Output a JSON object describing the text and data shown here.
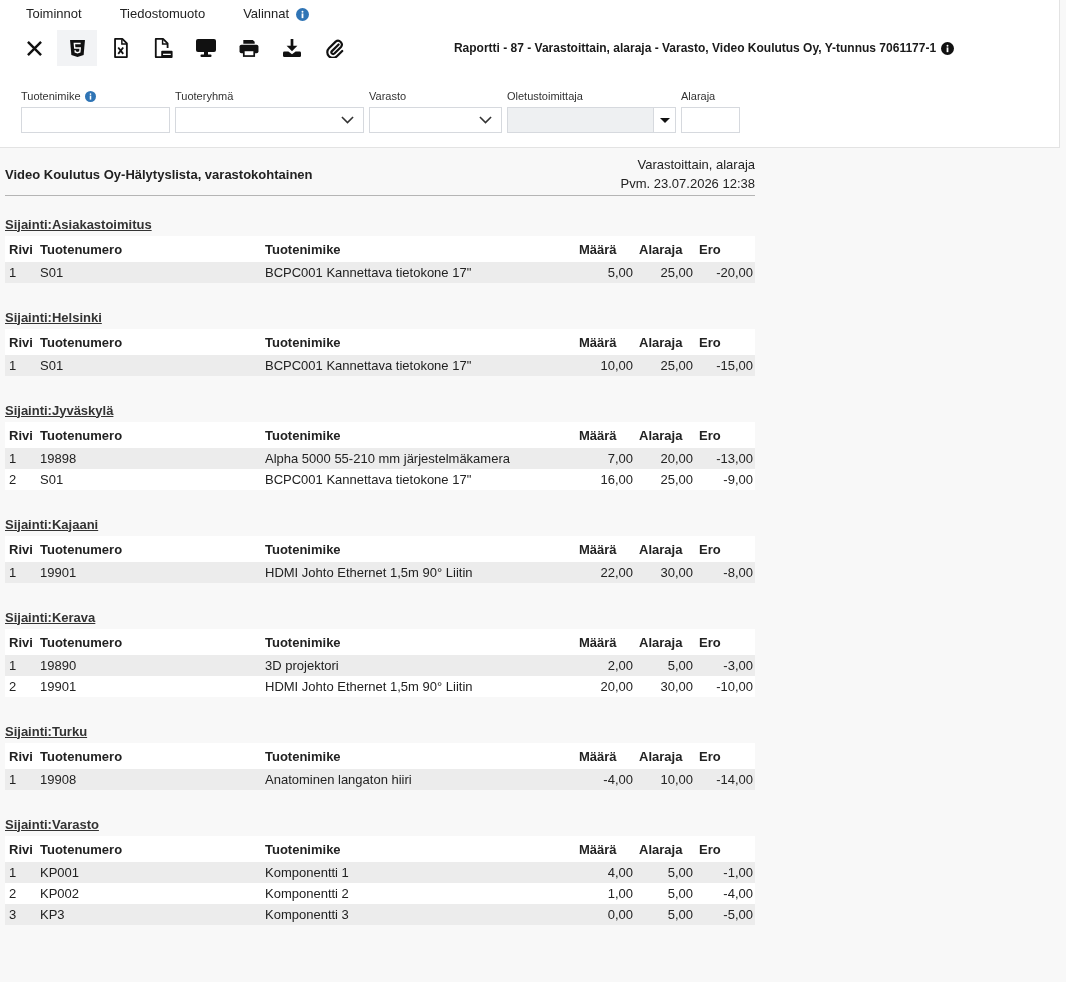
{
  "menu": [
    {
      "label": "Toiminnot",
      "info": false
    },
    {
      "label": "Tiedostomuoto",
      "info": false
    },
    {
      "label": "Valinnat",
      "info": true
    }
  ],
  "toolbar": [
    {
      "kind": "close",
      "selected": false
    },
    {
      "kind": "html",
      "selected": true
    },
    {
      "kind": "excel",
      "selected": false
    },
    {
      "kind": "pdf",
      "selected": false
    },
    {
      "kind": "screen",
      "selected": false
    },
    {
      "kind": "print",
      "selected": false
    },
    {
      "kind": "download",
      "selected": false
    },
    {
      "kind": "attach",
      "selected": false
    }
  ],
  "report_title": {
    "text": "Raportti - 87 - Varastoittain, alaraja - Varasto, Video Koulutus Oy, Y-tunnus 7061177-1",
    "info": true
  },
  "filters": [
    {
      "label": "Tuotenimike",
      "kind": "text",
      "info": true,
      "disabled": false
    },
    {
      "label": "Tuoteryhmä",
      "kind": "select",
      "info": false,
      "disabled": false
    },
    {
      "label": "Varasto",
      "kind": "select",
      "info": false,
      "disabled": false
    },
    {
      "label": "Oletustoimittaja",
      "kind": "combo",
      "info": false,
      "disabled": true
    },
    {
      "label": "Alaraja",
      "kind": "text",
      "info": false,
      "disabled": false
    }
  ],
  "report": {
    "title": "Video Koulutus Oy-Hälytyslista, varastokohtainen",
    "subtitle": "Varastoittain, alaraja",
    "date": "Pvm. 23.07.2026 12:38",
    "sections": [
      {
        "location": "Sijainti:Asiakastoimitus",
        "columns": [
          "Rivi",
          "Tuotenumero",
          "Tuotenimike",
          "Määrä",
          "Alaraja",
          "Ero"
        ],
        "rows": [
          [
            "1",
            "S01",
            "BCPC001 Kannettava tietokone 17\"",
            "5,00",
            "25,00",
            "-20,00"
          ]
        ]
      },
      {
        "location": "Sijainti:Helsinki",
        "columns": [
          "Rivi",
          "Tuotenumero",
          "Tuotenimike",
          "Määrä",
          "Alaraja",
          "Ero"
        ],
        "rows": [
          [
            "1",
            "S01",
            "BCPC001 Kannettava tietokone 17\"",
            "10,00",
            "25,00",
            "-15,00"
          ]
        ]
      },
      {
        "location": "Sijainti:Jyväskylä",
        "columns": [
          "Rivi",
          "Tuotenumero",
          "Tuotenimike",
          "Määrä",
          "Alaraja",
          "Ero"
        ],
        "rows": [
          [
            "1",
            "19898",
            "Alpha 5000 55-210 mm järjestelmäkamera",
            "7,00",
            "20,00",
            "-13,00"
          ],
          [
            "2",
            "S01",
            "BCPC001 Kannettava tietokone 17\"",
            "16,00",
            "25,00",
            "-9,00"
          ]
        ]
      },
      {
        "location": "Sijainti:Kajaani",
        "columns": [
          "Rivi",
          "Tuotenumero",
          "Tuotenimike",
          "Määrä",
          "Alaraja",
          "Ero"
        ],
        "rows": [
          [
            "1",
            "19901",
            "HDMI Johto Ethernet 1,5m 90° Liitin",
            "22,00",
            "30,00",
            "-8,00"
          ]
        ]
      },
      {
        "location": "Sijainti:Kerava",
        "columns": [
          "Rivi",
          "Tuotenumero",
          "Tuotenimike",
          "Määrä",
          "Alaraja",
          "Ero"
        ],
        "rows": [
          [
            "1",
            "19890",
            "3D projektori",
            "2,00",
            "5,00",
            "-3,00"
          ],
          [
            "2",
            "19901",
            "HDMI Johto Ethernet 1,5m 90° Liitin",
            "20,00",
            "30,00",
            "-10,00"
          ]
        ]
      },
      {
        "location": "Sijainti:Turku",
        "columns": [
          "Rivi",
          "Tuotenumero",
          "Tuotenimike",
          "Määrä",
          "Alaraja",
          "Ero"
        ],
        "rows": [
          [
            "1",
            "19908",
            "Anatominen langaton hiiri",
            "-4,00",
            "10,00",
            "-14,00"
          ]
        ]
      },
      {
        "location": "Sijainti:Varasto",
        "columns": [
          "Rivi",
          "Tuotenumero",
          "Tuotenimike",
          "Määrä",
          "Alaraja",
          "Ero"
        ],
        "rows": [
          [
            "1",
            "KP001",
            "Komponentti 1",
            "4,00",
            "5,00",
            "-1,00"
          ],
          [
            "2",
            "KP002",
            "Komponentti 2",
            "1,00",
            "5,00",
            "-4,00"
          ],
          [
            "3",
            "KP3",
            "Komponentti 3",
            "0,00",
            "5,00",
            "-5,00"
          ]
        ]
      }
    ]
  }
}
